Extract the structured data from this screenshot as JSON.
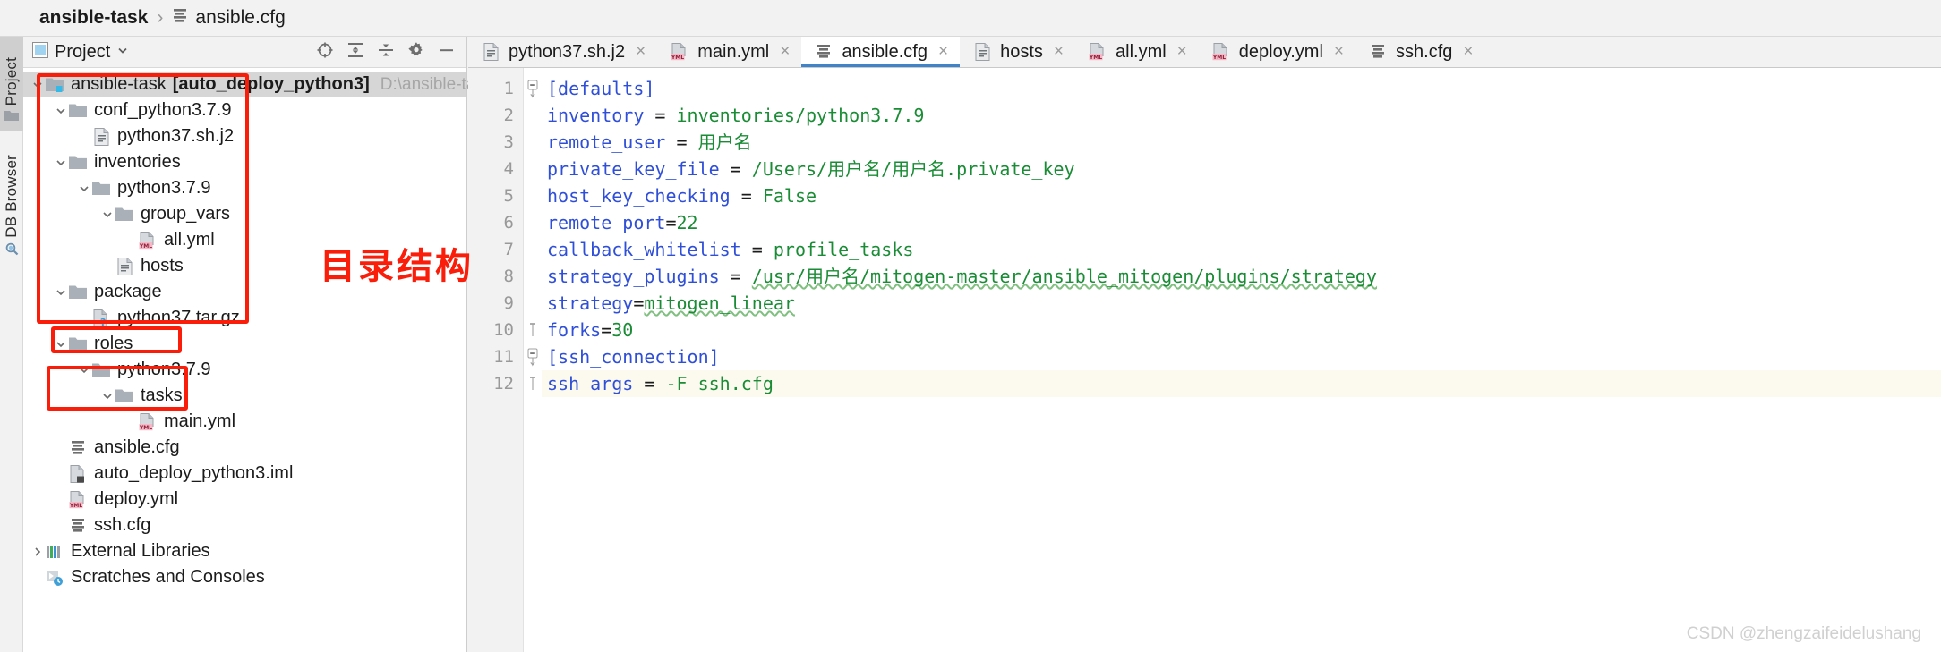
{
  "breadcrumb": {
    "project": "ansible-task",
    "separator": "›",
    "file": "ansible.cfg"
  },
  "tool_strip": {
    "tabs": [
      {
        "label": "Project",
        "icon": "folder-icon",
        "active": true
      },
      {
        "label": "DB Browser",
        "icon": "db-browser-icon",
        "active": false
      }
    ]
  },
  "project_panel": {
    "title": "Project",
    "dropdown_icon": "chevron-down-icon",
    "toolbar_icons": [
      "locate-target-icon",
      "expand-all-icon",
      "collapse-all-icon",
      "settings-gear-icon",
      "hide-panel-icon"
    ],
    "tree": [
      {
        "depth": 0,
        "arrow": "down",
        "icon": "module-folder-icon",
        "label": "ansible-task",
        "bold_suffix": "[auto_deploy_python3]",
        "path": "D:\\ansible-task",
        "selected": true
      },
      {
        "depth": 1,
        "arrow": "down",
        "icon": "folder-icon",
        "label": "conf_python3.7.9"
      },
      {
        "depth": 2,
        "arrow": "none",
        "icon": "text-file-icon",
        "label": "python37.sh.j2"
      },
      {
        "depth": 1,
        "arrow": "down",
        "icon": "folder-icon",
        "label": "inventories"
      },
      {
        "depth": 2,
        "arrow": "down",
        "icon": "folder-icon",
        "label": "python3.7.9"
      },
      {
        "depth": 3,
        "arrow": "down",
        "icon": "folder-icon",
        "label": "group_vars"
      },
      {
        "depth": 4,
        "arrow": "none",
        "icon": "yml-file-icon",
        "label": "all.yml"
      },
      {
        "depth": 3,
        "arrow": "none",
        "icon": "text-file-icon",
        "label": "hosts"
      },
      {
        "depth": 1,
        "arrow": "down",
        "icon": "folder-icon",
        "label": "package"
      },
      {
        "depth": 2,
        "arrow": "none",
        "icon": "unknown-file-icon",
        "label": "python37.tar.gz"
      },
      {
        "depth": 1,
        "arrow": "down",
        "icon": "folder-icon",
        "label": "roles"
      },
      {
        "depth": 2,
        "arrow": "down",
        "icon": "folder-icon",
        "label": "python3.7.9"
      },
      {
        "depth": 3,
        "arrow": "down",
        "icon": "folder-icon",
        "label": "tasks"
      },
      {
        "depth": 4,
        "arrow": "none",
        "icon": "yml-file-icon",
        "label": "main.yml"
      },
      {
        "depth": 1,
        "arrow": "none",
        "icon": "cfg-file-icon",
        "label": "ansible.cfg"
      },
      {
        "depth": 1,
        "arrow": "none",
        "icon": "iml-file-icon",
        "label": "auto_deploy_python3.iml"
      },
      {
        "depth": 1,
        "arrow": "none",
        "icon": "yml-file-icon",
        "label": "deploy.yml"
      },
      {
        "depth": 1,
        "arrow": "none",
        "icon": "cfg-file-icon",
        "label": "ssh.cfg"
      },
      {
        "depth": 0,
        "arrow": "right",
        "icon": "libraries-icon",
        "label": "External Libraries"
      },
      {
        "depth": 0,
        "arrow": "none",
        "icon": "scratches-icon",
        "label": "Scratches and Consoles"
      }
    ]
  },
  "annotation": {
    "label": "目录结构",
    "color": "#f91d0a"
  },
  "editor": {
    "tabs": [
      {
        "label": "python37.sh.j2",
        "icon": "text-file-icon",
        "active": false,
        "close": "×"
      },
      {
        "label": "main.yml",
        "icon": "yml-file-icon",
        "active": false,
        "close": "×"
      },
      {
        "label": "ansible.cfg",
        "icon": "cfg-file-icon",
        "active": true,
        "close": "×"
      },
      {
        "label": "hosts",
        "icon": "text-file-icon",
        "active": false,
        "close": "×"
      },
      {
        "label": "all.yml",
        "icon": "yml-file-icon",
        "active": false,
        "close": "×"
      },
      {
        "label": "deploy.yml",
        "icon": "yml-file-icon",
        "active": false,
        "close": "×"
      },
      {
        "label": "ssh.cfg",
        "icon": "cfg-file-icon",
        "active": false,
        "close": "×"
      }
    ],
    "line_numbers": [
      "1",
      "2",
      "3",
      "4",
      "5",
      "6",
      "7",
      "8",
      "9",
      "10",
      "11",
      "12"
    ],
    "lines": [
      {
        "n": 1,
        "fold": "minus-open",
        "current": false,
        "parts": [
          {
            "t": "[defaults]",
            "c": "k"
          }
        ]
      },
      {
        "n": 2,
        "fold": "none",
        "current": false,
        "parts": [
          {
            "t": "inventory",
            "c": "k"
          },
          {
            "t": " = ",
            "c": "op"
          },
          {
            "t": "inventories/python3.7.9",
            "c": "v"
          }
        ]
      },
      {
        "n": 3,
        "fold": "none",
        "current": false,
        "parts": [
          {
            "t": "remote_user",
            "c": "k"
          },
          {
            "t": " = ",
            "c": "op"
          },
          {
            "t": "用户名",
            "c": "v"
          }
        ]
      },
      {
        "n": 4,
        "fold": "none",
        "current": false,
        "parts": [
          {
            "t": "private_key_file",
            "c": "k"
          },
          {
            "t": " = ",
            "c": "op"
          },
          {
            "t": "/Users/用户名/用户名.private_key",
            "c": "v"
          }
        ]
      },
      {
        "n": 5,
        "fold": "none",
        "current": false,
        "parts": [
          {
            "t": "host_key_checking",
            "c": "k"
          },
          {
            "t": " = ",
            "c": "op"
          },
          {
            "t": "False",
            "c": "v"
          }
        ]
      },
      {
        "n": 6,
        "fold": "none",
        "current": false,
        "parts": [
          {
            "t": "remote_port",
            "c": "k"
          },
          {
            "t": "=",
            "c": "op"
          },
          {
            "t": "22",
            "c": "v"
          }
        ]
      },
      {
        "n": 7,
        "fold": "none",
        "current": false,
        "parts": [
          {
            "t": "callback_whitelist",
            "c": "k"
          },
          {
            "t": " = ",
            "c": "op"
          },
          {
            "t": "profile_tasks",
            "c": "v"
          }
        ]
      },
      {
        "n": 8,
        "fold": "none",
        "current": false,
        "parts": [
          {
            "t": "strategy_plugins",
            "c": "k"
          },
          {
            "t": " = ",
            "c": "op"
          },
          {
            "t": "/usr/用户名/mitogen-master/ansible_mitogen/plugins/strategy",
            "c": "v sq"
          }
        ]
      },
      {
        "n": 9,
        "fold": "none",
        "current": false,
        "parts": [
          {
            "t": "strategy",
            "c": "k"
          },
          {
            "t": "=",
            "c": "op"
          },
          {
            "t": "mitogen_linear",
            "c": "v sq"
          }
        ]
      },
      {
        "n": 10,
        "fold": "minus-close",
        "current": false,
        "parts": [
          {
            "t": "forks",
            "c": "k"
          },
          {
            "t": "=",
            "c": "op"
          },
          {
            "t": "30",
            "c": "v"
          }
        ]
      },
      {
        "n": 11,
        "fold": "minus-open",
        "current": false,
        "parts": [
          {
            "t": "[ssh_connection]",
            "c": "k"
          }
        ]
      },
      {
        "n": 12,
        "fold": "minus-close",
        "current": true,
        "parts": [
          {
            "t": "ssh_args",
            "c": "k"
          },
          {
            "t": " = ",
            "c": "op"
          },
          {
            "t": "-F ssh.cfg",
            "c": "v"
          }
        ]
      }
    ]
  },
  "watermark": {
    "text": "CSDN @zhengzaifeidelushang"
  }
}
